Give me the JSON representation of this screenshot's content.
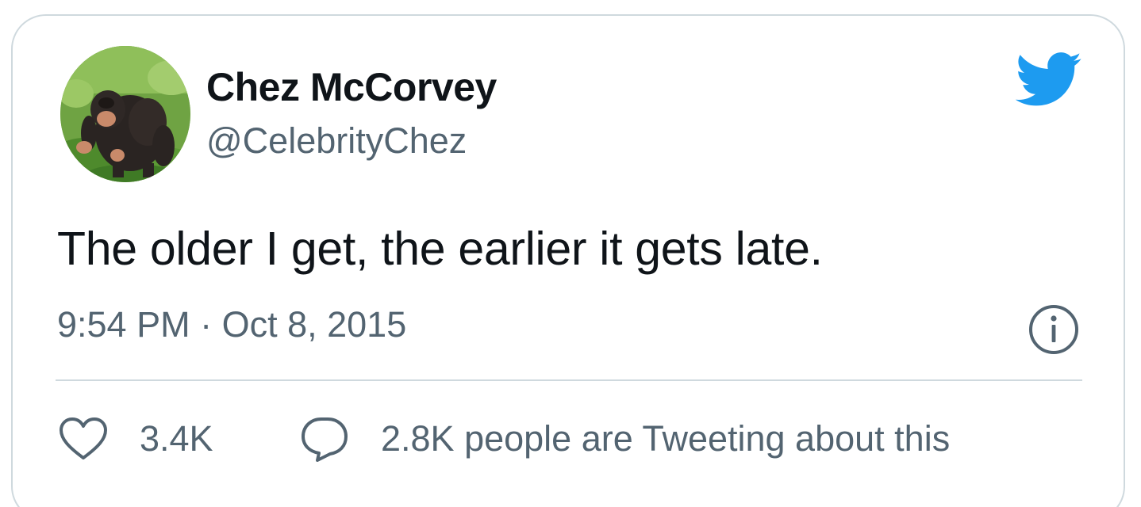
{
  "author": {
    "display_name": "Chez McCorvey",
    "handle": "@CelebrityChez",
    "avatar_icon": "chimpanzee-avatar"
  },
  "tweet": {
    "text": "The older I get, the earlier it gets late.",
    "timestamp": "9:54 PM · Oct 8, 2015"
  },
  "actions": {
    "likes": "3.4K",
    "tweeting_about": "2.8K people are Tweeting about this"
  },
  "icons": {
    "brand": "twitter-bird-icon",
    "info": "info-icon",
    "like": "heart-icon",
    "reply": "speech-bubble-icon"
  },
  "colors": {
    "brand_blue": "#1d9bf0",
    "text_primary": "#0f1419",
    "text_secondary": "#536471",
    "border": "#cfd9de"
  }
}
